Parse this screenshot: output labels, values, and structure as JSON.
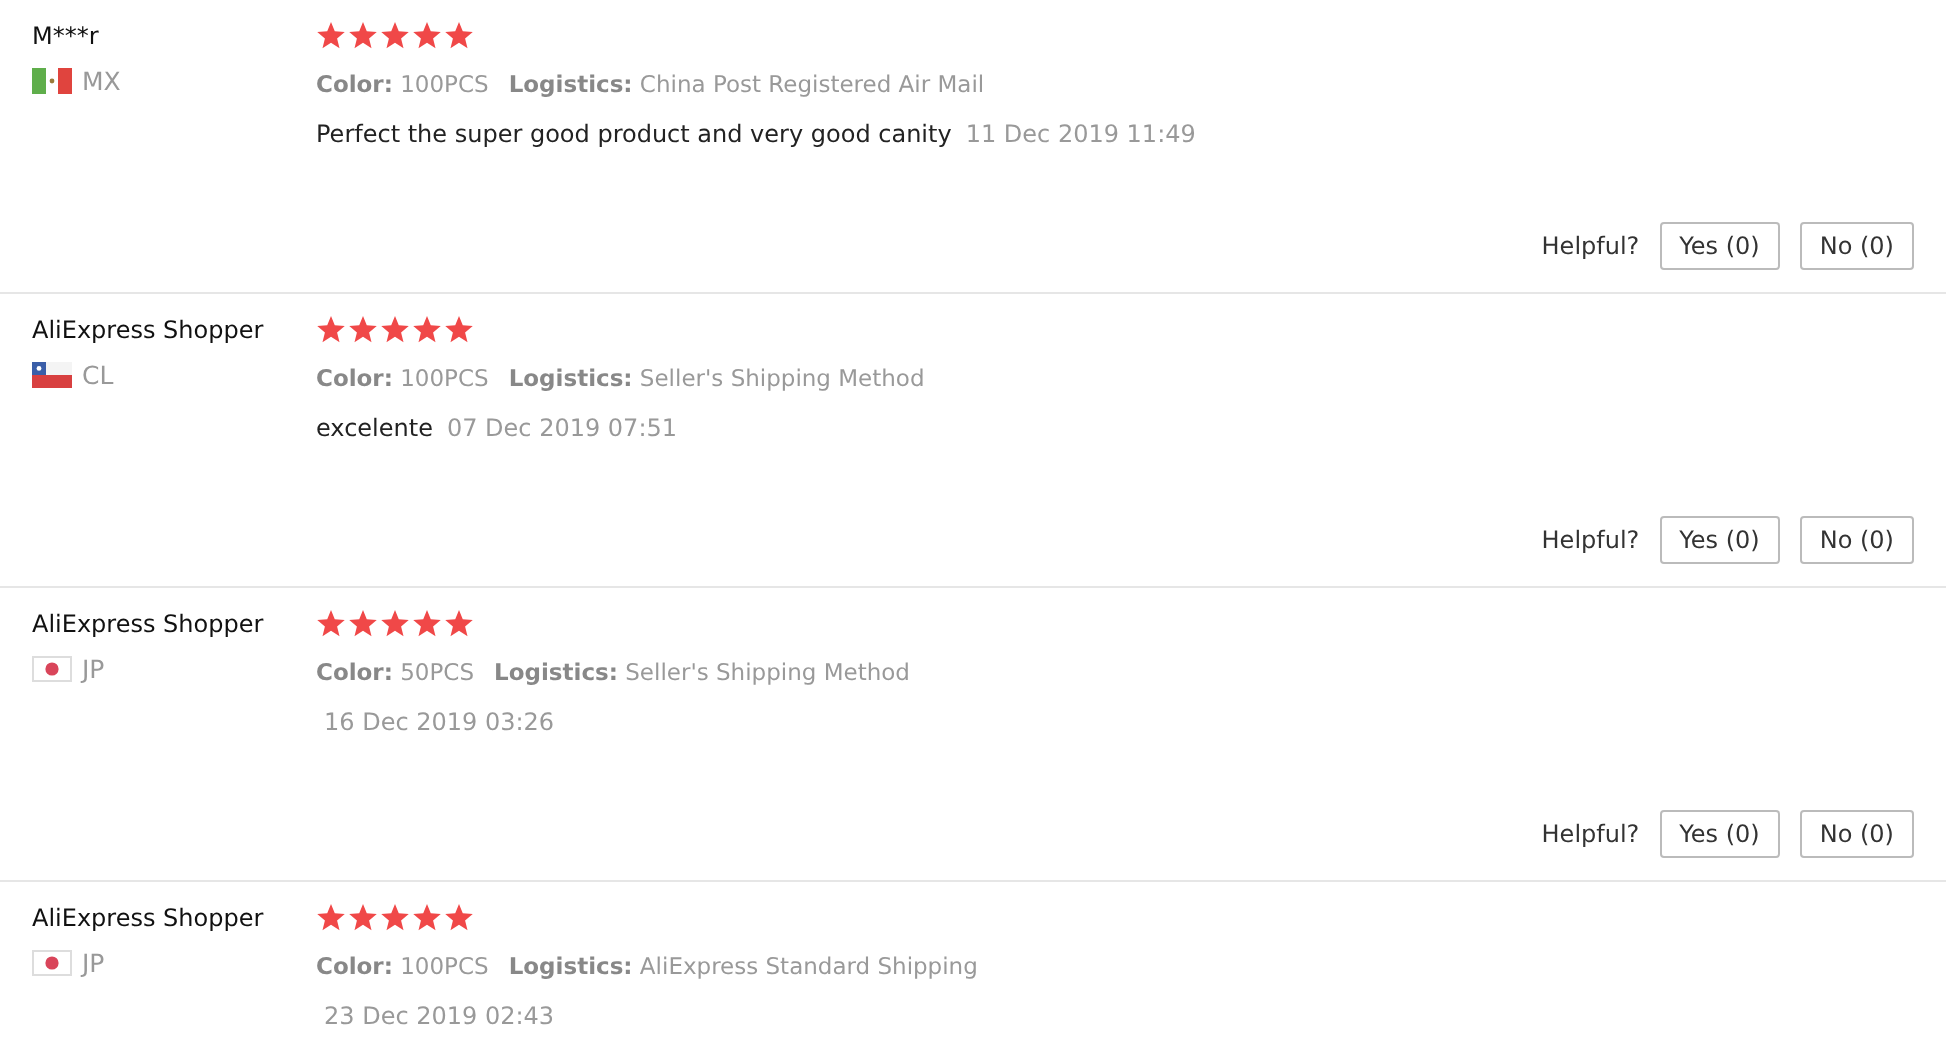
{
  "reviews": [
    {
      "name": "M***r",
      "stars": 5,
      "kind": "mx",
      "country": "MX",
      "color_label": "Color:",
      "variant": "100PCS",
      "logistics_label": "Logistics:",
      "logistics": "China Post Registered Air Mail",
      "comment": "Perfect the super good product and very good canity",
      "date": "11 Dec 2019 11:49",
      "helpful": {
        "label": "Helpful?",
        "yes": "Yes (0)",
        "no": "No (0)"
      }
    },
    {
      "name": "AliExpress Shopper",
      "stars": 5,
      "kind": "cl",
      "country": "CL",
      "color_label": "Color:",
      "variant": "100PCS",
      "logistics_label": "Logistics:",
      "logistics": "Seller's Shipping Method",
      "comment": "excelente",
      "date": "07 Dec 2019 07:51",
      "helpful": {
        "label": "Helpful?",
        "yes": "Yes (0)",
        "no": "No (0)"
      }
    },
    {
      "name": "AliExpress Shopper",
      "stars": 5,
      "kind": "jp",
      "country": "JP",
      "color_label": "Color:",
      "variant": "50PCS",
      "logistics_label": "Logistics:",
      "logistics": "Seller's Shipping Method",
      "date": "16 Dec 2019 03:26",
      "helpful": {
        "label": "Helpful?",
        "yes": "Yes (0)",
        "no": "No (0)"
      }
    },
    {
      "name": "AliExpress Shopper",
      "stars": 5,
      "kind": "jp",
      "country": "JP",
      "color_label": "Color:",
      "variant": "100PCS",
      "logistics_label": "Logistics:",
      "logistics": "AliExpress Standard Shipping",
      "date": "23 Dec 2019 02:43"
    }
  ]
}
